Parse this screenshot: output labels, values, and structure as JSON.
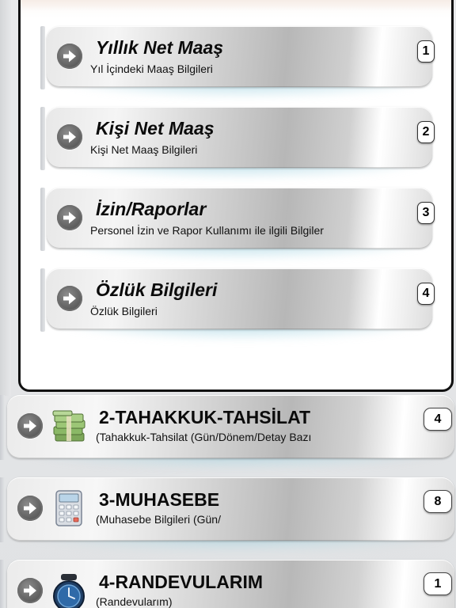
{
  "colors": {
    "panel_border": "#111111",
    "button_silver": "#c0c0c0",
    "glow": "#7fc1d4",
    "arrow_circle": "#5a5a5a"
  },
  "sub_menu": [
    {
      "title": "Yıllık Net Maaş",
      "subtitle": "Yıl İçindeki Maaş Bilgileri",
      "badge": "1",
      "icon": "arrow-right-icon"
    },
    {
      "title": "Kişi Net Maaş",
      "subtitle": "Kişi Net Maaş Bilgileri",
      "badge": "2",
      "icon": "arrow-right-icon"
    },
    {
      "title": "İzin/Raporlar",
      "subtitle": "Personel İzin ve Rapor Kullanımı ile ilgili Bilgiler",
      "badge": "3",
      "icon": "arrow-right-icon"
    },
    {
      "title": "Özlük Bilgileri",
      "subtitle": "Özlük Bilgileri",
      "badge": "4",
      "icon": "arrow-right-icon"
    }
  ],
  "main_menu": [
    {
      "title": "2-TAHAKKUK-TAHSİLAT",
      "subtitle": "(Tahakkuk-Tahsilat (Gün/Dönem/Detay Bazı",
      "badge": "4",
      "icon": "money-stack-icon"
    },
    {
      "title": "3-MUHASEBE",
      "subtitle": "(Muhasebe Bilgileri (Gün/",
      "badge": "8",
      "icon": "calculator-icon"
    },
    {
      "title": "4-RANDEVULARIM",
      "subtitle": "(Randevularım)",
      "badge": "1",
      "icon": "alarm-clock-icon"
    }
  ]
}
